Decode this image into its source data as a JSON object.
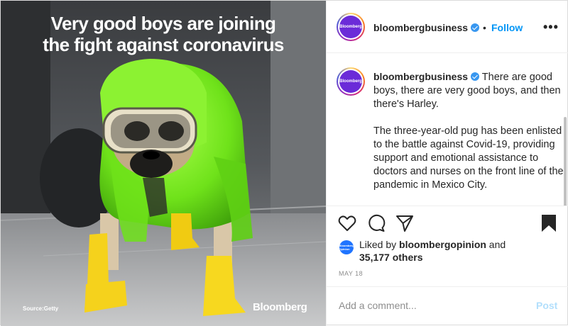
{
  "image": {
    "headline_line1": "Very good boys are joining",
    "headline_line2": "the fight against coronavirus",
    "source": "Source:Getty",
    "brand": "Bloomberg"
  },
  "header": {
    "avatar_text": "Bloomberg",
    "username": "bloombergbusiness",
    "separator": "•",
    "follow_label": "Follow",
    "more_label": "•••"
  },
  "caption": {
    "avatar_text": "Bloomberg",
    "username": "bloombergbusiness",
    "lead": " There are good boys, there are very good boys, and then there's Harley.",
    "body": "The three-year-old pug has been enlisted to the battle against Covid-19, providing support and emotional assistance to doctors and nurses on the front line of the pandemic in Mexico City."
  },
  "likes": {
    "avatar_text": "Bloomberg Opinion",
    "prefix": "Liked by ",
    "user": "bloombergopinion",
    "suffix": " and",
    "others": "35,177 others"
  },
  "date": "MAY 18",
  "comment": {
    "placeholder": "Add a comment...",
    "post_label": "Post"
  },
  "colors": {
    "accent": "#0095f6",
    "verified": "#3897f0",
    "post_disabled": "#b2dffc"
  },
  "icons": [
    "heart-icon",
    "comment-icon",
    "share-icon",
    "bookmark-icon",
    "verified-icon",
    "more-icon"
  ]
}
